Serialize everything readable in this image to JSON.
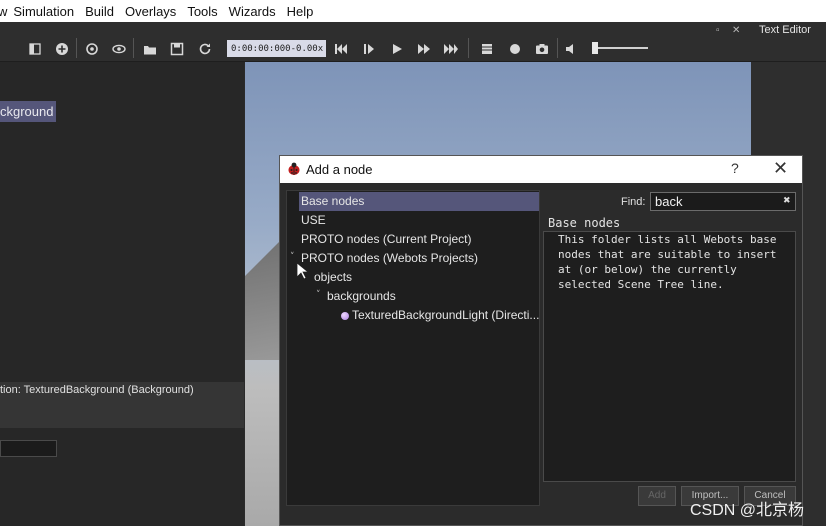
{
  "menubar": {
    "items": [
      "w",
      "Simulation",
      "Build",
      "Overlays",
      "Tools",
      "Wizards",
      "Help"
    ]
  },
  "toolbar": {
    "time": "0:00:00:000",
    "speed": "0.00x",
    "icons": [
      "toggle-panel-icon",
      "add-node-icon",
      "reset-view-icon",
      "visibility-icon",
      "open-world-icon",
      "save-world-icon",
      "reload-icon",
      "step-back-icon",
      "step-icon",
      "play-icon",
      "fast-forward-icon",
      "fastest-icon",
      "stop-icon",
      "record-icon",
      "screenshot-icon",
      "volume-icon"
    ]
  },
  "right_panel": {
    "title": "Text Editor"
  },
  "scene_tree": {
    "selected_node": "ckground",
    "status": "tion: TexturedBackground (Background)"
  },
  "dialog": {
    "title": "Add a node",
    "help": "?",
    "tree": [
      {
        "label": "Base nodes",
        "level": 0,
        "selected": true
      },
      {
        "label": "USE",
        "level": 0
      },
      {
        "label": "PROTO nodes (Current Project)",
        "level": 0
      },
      {
        "label": "PROTO nodes (Webots Projects)",
        "level": 0,
        "expanded": true
      },
      {
        "label": "objects",
        "level": 1,
        "expanded": true
      },
      {
        "label": "backgrounds",
        "level": 2,
        "expanded": true
      },
      {
        "label": "TexturedBackgroundLight (Directi...",
        "level": 3
      }
    ],
    "find_label": "Find:",
    "find_value": "back",
    "description_title": "Base nodes",
    "description_text": "This folder lists all Webots base nodes that are suitable to insert at (or below) the currently selected Scene Tree line.",
    "buttons": {
      "add": "Add",
      "import": "Import...",
      "cancel": "Cancel"
    }
  },
  "watermark": "CSDN @北京杨",
  "colors": {
    "selection": "#55567a",
    "dialog_bg": "#2b2b2b",
    "toolbar_bg": "#2e2e2e"
  }
}
